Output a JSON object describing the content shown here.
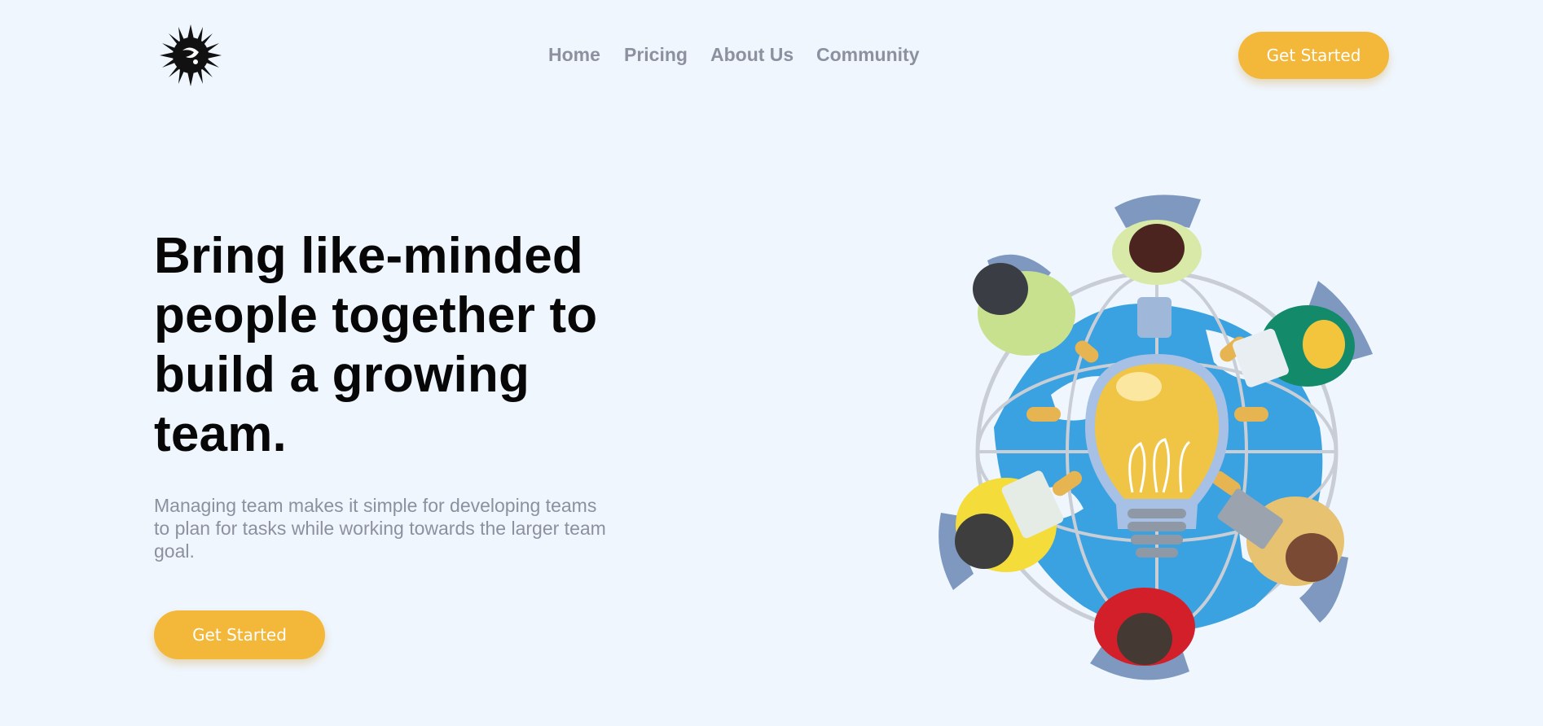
{
  "header": {
    "logo_icon": "sunburst-people-logo",
    "nav": [
      {
        "label": "Home"
      },
      {
        "label": "Pricing"
      },
      {
        "label": "About Us"
      },
      {
        "label": "Community"
      }
    ],
    "cta_label": "Get Started"
  },
  "hero": {
    "title": "Bring like-minded people together to build a growing team.",
    "description": "Managing team makes it simple for developing teams to plan for tasks while working towards the larger team goal.",
    "cta_label": "Get Started",
    "illustration_icon": "team-around-lightbulb-globe-illustration"
  },
  "colors": {
    "background": "#eff6fe",
    "accent": "#f3b73a",
    "nav_text": "#8c909f",
    "heading": "#070707",
    "globe_blue": "#3aa2e0"
  }
}
